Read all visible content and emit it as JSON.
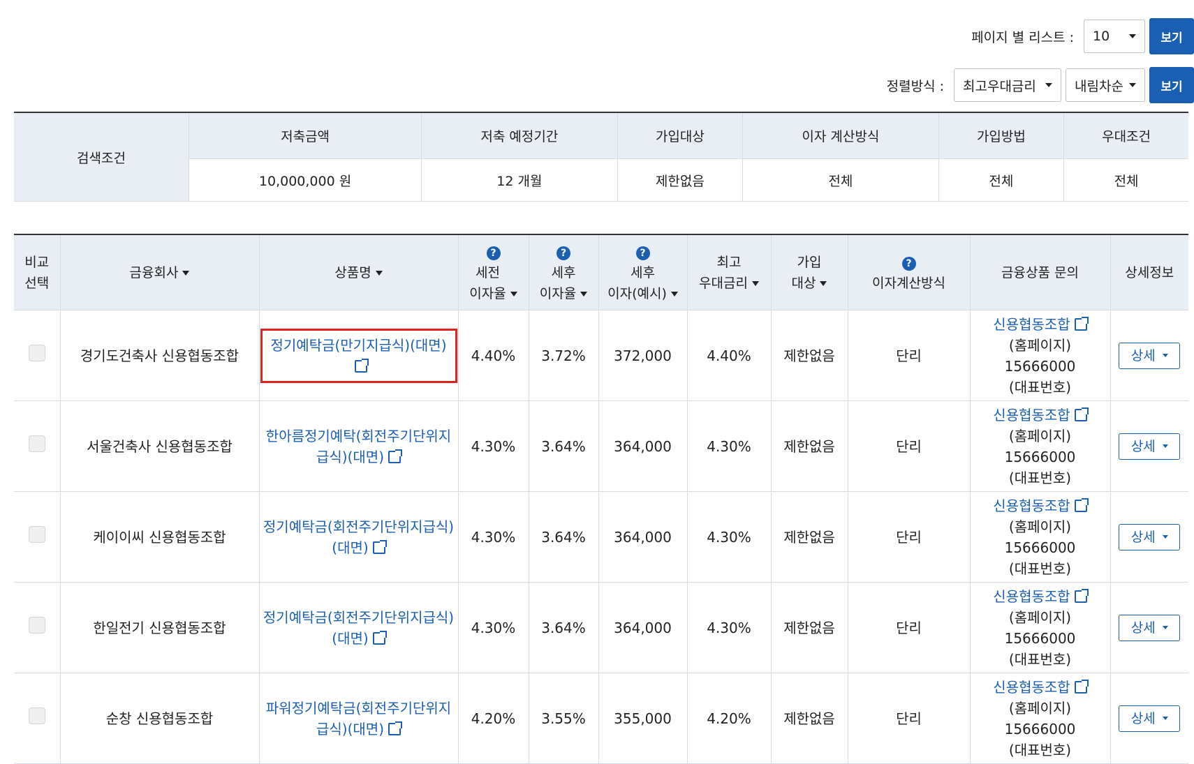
{
  "controls": {
    "per_page_label": "페이지 별 리스트 :",
    "per_page_value": "10",
    "view_label": "보기",
    "sort_label": "정렬방식 :",
    "sort_field": "최고우대금리",
    "sort_order": "내림차순"
  },
  "conditions": {
    "label": "검색조건",
    "headers": [
      "저축금액",
      "저축 예정기간",
      "가입대상",
      "이자 계산방식",
      "가입방법",
      "우대조건"
    ],
    "values": [
      "10,000,000 원",
      "12 개월",
      "제한없음",
      "전체",
      "전체",
      "전체"
    ]
  },
  "table": {
    "headers": {
      "compare": [
        "비교",
        "선택"
      ],
      "company": "금융회사",
      "product": "상품명",
      "pre_tax": [
        "세전",
        "이자율"
      ],
      "post_tax": [
        "세후",
        "이자율"
      ],
      "post_interest": [
        "세후",
        "이자(예시)"
      ],
      "max_rate": [
        "최고",
        "우대금리"
      ],
      "target": [
        "가입",
        "대상"
      ],
      "calc": "이자계산방식",
      "inquiry": "금융상품 문의",
      "detail": "상세정보",
      "help_glyph": "?"
    },
    "rows": [
      {
        "company": "경기도건축사 신용협동조합",
        "product": "정기예탁금(만기지급식)(대면)",
        "pre_tax": "4.40%",
        "post_tax": "3.72%",
        "interest": "372,000",
        "max_rate": "4.40%",
        "target": "제한없음",
        "calc": "단리",
        "inq_link": "신용협동조합",
        "inq_home": "(홈페이지)",
        "inq_phone": "15666000",
        "inq_rep": "(대표번호)",
        "detail": "상세"
      },
      {
        "company": "서울건축사 신용협동조합",
        "product": "한아름정기예탁(회전주기단위지급식)(대면)",
        "pre_tax": "4.30%",
        "post_tax": "3.64%",
        "interest": "364,000",
        "max_rate": "4.30%",
        "target": "제한없음",
        "calc": "단리",
        "inq_link": "신용협동조합",
        "inq_home": "(홈페이지)",
        "inq_phone": "15666000",
        "inq_rep": "(대표번호)",
        "detail": "상세"
      },
      {
        "company": "케이이씨 신용협동조합",
        "product": "정기예탁금(회전주기단위지급식)(대면)",
        "pre_tax": "4.30%",
        "post_tax": "3.64%",
        "interest": "364,000",
        "max_rate": "4.30%",
        "target": "제한없음",
        "calc": "단리",
        "inq_link": "신용협동조합",
        "inq_home": "(홈페이지)",
        "inq_phone": "15666000",
        "inq_rep": "(대표번호)",
        "detail": "상세"
      },
      {
        "company": "한일전기 신용협동조합",
        "product": "정기예탁금(회전주기단위지급식)(대면)",
        "pre_tax": "4.30%",
        "post_tax": "3.64%",
        "interest": "364,000",
        "max_rate": "4.30%",
        "target": "제한없음",
        "calc": "단리",
        "inq_link": "신용협동조합",
        "inq_home": "(홈페이지)",
        "inq_phone": "15666000",
        "inq_rep": "(대표번호)",
        "detail": "상세"
      },
      {
        "company": "순창 신용협동조합",
        "product": "파워정기예탁금(회전주기단위지급식)(대면)",
        "pre_tax": "4.20%",
        "post_tax": "3.55%",
        "interest": "355,000",
        "max_rate": "4.20%",
        "target": "제한없음",
        "calc": "단리",
        "inq_link": "신용협동조합",
        "inq_home": "(홈페이지)",
        "inq_phone": "15666000",
        "inq_rep": "(대표번호)",
        "detail": "상세"
      }
    ]
  },
  "colors": {
    "accent": "#1b5fb3",
    "header_bg": "#e9eef5",
    "highlight": "#e0241b"
  },
  "icons": {
    "help": "question-circle-icon",
    "external": "external-link-icon",
    "sort": "caret-down-icon"
  }
}
